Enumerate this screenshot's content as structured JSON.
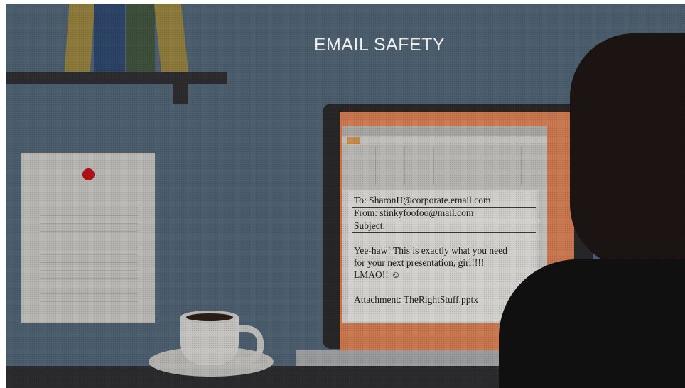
{
  "slide": {
    "title": "EMAIL SAFETY"
  },
  "email": {
    "to": "To: SharonH@corporate.email.com",
    "from": "From: stinkyfoofoo@mail.com",
    "subject": "Subject:",
    "body_line1": "Yee-haw! This is exactly what you need",
    "body_line2": "for your next presentation, girl!!!!",
    "body_line3": "LMAO!! ☺",
    "attachment": "Attachment: TheRightStuff.pptx"
  },
  "colors": {
    "wall": "#4c5d6d",
    "screen_orange": "#c9784f",
    "pin_red": "#b01117",
    "title_text": "#f2f2f2"
  }
}
